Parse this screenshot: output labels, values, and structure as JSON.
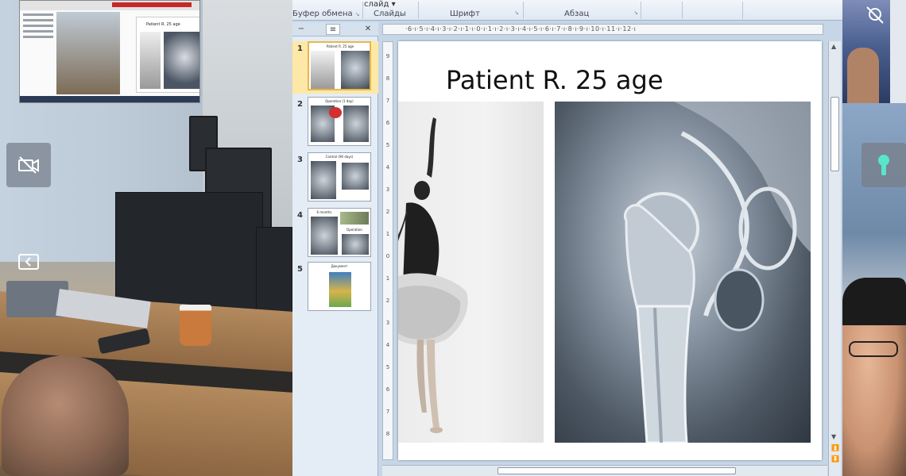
{
  "ribbon": {
    "top_item": "слайд",
    "groups": [
      {
        "label": "Буфер обмена"
      },
      {
        "label": "Слайды"
      },
      {
        "label": "Шрифт"
      },
      {
        "label": "Абзац"
      }
    ]
  },
  "slide_panel": {
    "tabs": [
      {
        "icon": "slides-tab-icon"
      },
      {
        "icon": "outline-tab-icon"
      }
    ],
    "close_icon": "close-icon",
    "slides": [
      {
        "number": "1",
        "title": "Patient R. 25 age",
        "selected": true
      },
      {
        "number": "2",
        "title": "Operation (1 day)",
        "selected": false
      },
      {
        "number": "3",
        "title": "Control (90 days)",
        "selected": false
      },
      {
        "number": "4",
        "title": "6 months",
        "caption": "Operation",
        "selected": false
      },
      {
        "number": "5",
        "title": "Документ",
        "selected": false
      }
    ]
  },
  "ruler": {
    "horizontal": "·6·ı·5·ı·4·ı·3·ı·2·ı·1·ı·0·ı·1·ı·2·ı·3·ı·4·ı·5·ı·6·ı·7·ı·8·ı·9·ı·10·ı·11·ı·12·ı",
    "vertical": [
      "9",
      "8",
      "7",
      "6",
      "5",
      "4",
      "3",
      "2",
      "1",
      "0",
      "1",
      "2",
      "3",
      "4",
      "5",
      "6",
      "7",
      "8",
      "9"
    ]
  },
  "slide": {
    "title": "Patient R. 25 age"
  },
  "thumbnail_preview": {
    "slide_title": "Patient R. 25 age"
  },
  "overlay_buttons": {
    "camera_off_icon": "camera-off-icon",
    "collapse_icon": "collapse-left-icon",
    "key_icon": "keyhole-icon"
  },
  "colors": {
    "ribbon_bg": "#dfe8f2",
    "selected_slide": "#fde8a8",
    "panel_bg": "#e4ecf5",
    "overlay_button": "#78808c"
  }
}
